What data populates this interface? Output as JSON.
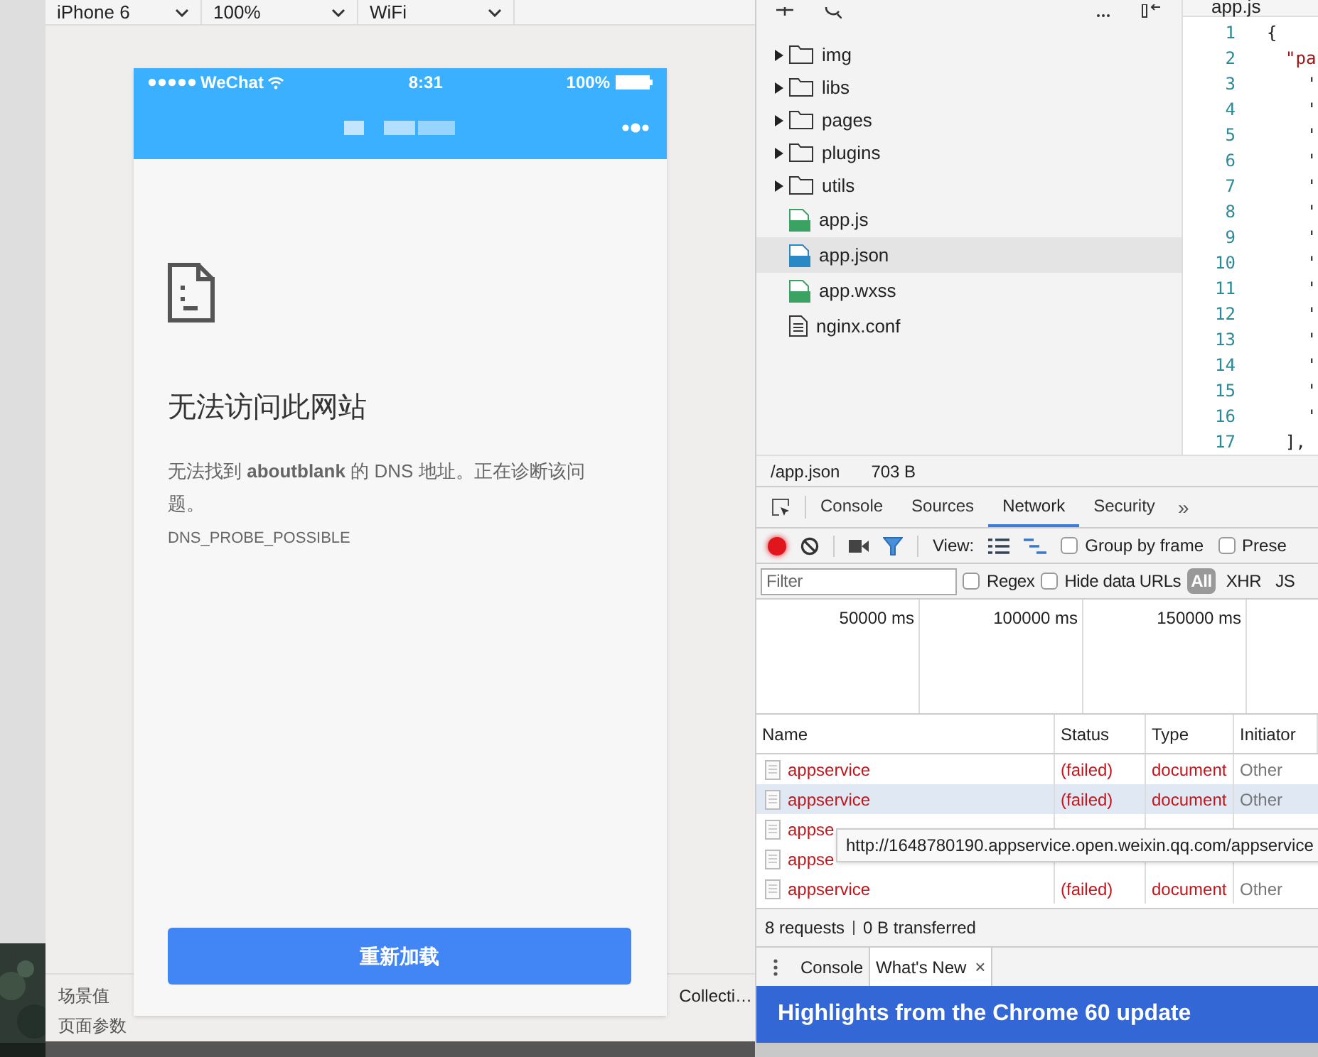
{
  "simulator_toolbar": {
    "device": "iPhone 6",
    "zoom": "100%",
    "network": "WiFi"
  },
  "phone": {
    "status_bar": {
      "carrier": "WeChat",
      "time": "8:31",
      "battery": "100%"
    },
    "error": {
      "title": "无法访问此网站",
      "message": "无法找到 **aboutblank** 的 DNS 地址。正在诊断该问题。",
      "code": "DNS_PROBE_POSSIBLE"
    },
    "reload_button": "重新加载"
  },
  "bottom_panel": {
    "labels": [
      "场景值",
      "页面参数"
    ],
    "side_text": "Collecti…"
  },
  "file_tree": [
    {
      "name": "img",
      "kind": "folder",
      "selected": false
    },
    {
      "name": "libs",
      "kind": "folder",
      "selected": false
    },
    {
      "name": "pages",
      "kind": "folder",
      "selected": false
    },
    {
      "name": "plugins",
      "kind": "folder",
      "selected": false
    },
    {
      "name": "utils",
      "kind": "folder",
      "selected": false
    },
    {
      "name": "app.js",
      "kind": "js",
      "selected": false
    },
    {
      "name": "app.json",
      "kind": "json",
      "selected": true
    },
    {
      "name": "app.wxss",
      "kind": "wxss",
      "selected": false
    },
    {
      "name": "nginx.conf",
      "kind": "text",
      "selected": false
    }
  ],
  "editor": {
    "tab": "app.js",
    "lines": [
      {
        "number": "1",
        "code": "{"
      },
      {
        "number": "2",
        "code": "\"pa"
      },
      {
        "number": "3",
        "code": "'"
      },
      {
        "number": "4",
        "code": "'"
      },
      {
        "number": "5",
        "code": "'"
      },
      {
        "number": "6",
        "code": "'"
      },
      {
        "number": "7",
        "code": "'"
      },
      {
        "number": "8",
        "code": "'"
      },
      {
        "number": "9",
        "code": "'"
      },
      {
        "number": "10",
        "code": "'"
      },
      {
        "number": "11",
        "code": "'"
      },
      {
        "number": "12",
        "code": "'"
      },
      {
        "number": "13",
        "code": "'"
      },
      {
        "number": "14",
        "code": "'"
      },
      {
        "number": "15",
        "code": "'"
      },
      {
        "number": "16",
        "code": "'"
      },
      {
        "number": "17",
        "code": "],"
      }
    ]
  },
  "file_status": {
    "path": "/app.json",
    "size": "703 B"
  },
  "devtools": {
    "tabs": [
      {
        "label": "Console",
        "selected": false
      },
      {
        "label": "Sources",
        "selected": false
      },
      {
        "label": "Network",
        "selected": true
      },
      {
        "label": "Security",
        "selected": false
      }
    ],
    "more": "»",
    "toolbar": {
      "recording": true,
      "view_label": "View:",
      "options": [
        {
          "label": "Group by frame",
          "checked": false
        },
        {
          "label": "Prese",
          "checked": false
        }
      ]
    },
    "filter": {
      "placeholder": "Filter",
      "options": [
        {
          "label": "Regex",
          "checked": false
        },
        {
          "label": "Hide data URLs",
          "checked": false
        }
      ],
      "types": [
        {
          "label": "All",
          "selected": true
        },
        {
          "label": "XHR",
          "selected": false
        },
        {
          "label": "JS",
          "selected": false
        }
      ]
    },
    "timeline_ticks": [
      "50000 ms",
      "100000 ms",
      "150000 ms"
    ],
    "columns": [
      "Name",
      "Status",
      "Type",
      "Initiator"
    ],
    "rows": [
      {
        "name": "appservice",
        "status": "(failed)",
        "type": "document",
        "initiator": "Other",
        "failed": true,
        "highlighted": false
      },
      {
        "name": "appservice",
        "status": "(failed)",
        "type": "document",
        "initiator": "Other",
        "failed": true,
        "highlighted": true
      },
      {
        "name": "appse",
        "failed": true,
        "highlighted": false
      },
      {
        "name": "appse",
        "failed": true,
        "highlighted": false
      },
      {
        "name": "appservice",
        "status": "(failed)",
        "type": "document",
        "initiator": "Other",
        "failed": true,
        "highlighted": false
      }
    ],
    "tooltip": "http://1648780190.appservice.open.weixin.qq.com/appservice",
    "summary": "8 requests",
    "transferred": "0 B transferred",
    "drawer_tabs": [
      {
        "label": "Console",
        "selected": false,
        "closable": false
      },
      {
        "label": "What's New",
        "selected": true,
        "closable": true
      }
    ],
    "close_mark": "×",
    "banner": "Highlights from the Chrome 60 update"
  }
}
